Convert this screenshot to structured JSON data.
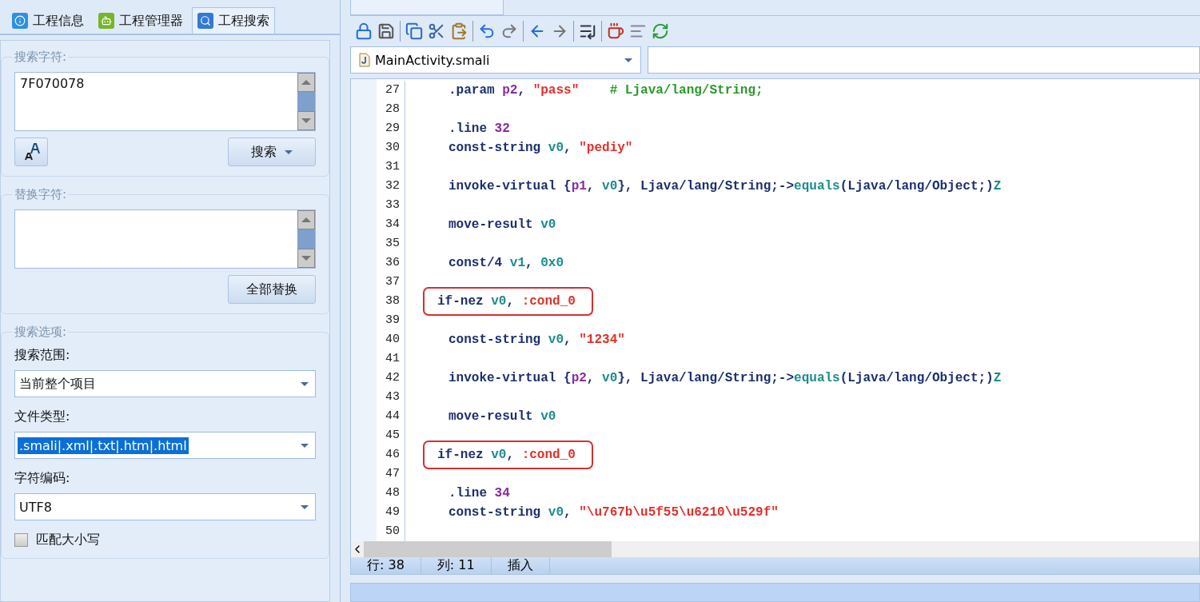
{
  "tabs": [
    {
      "label": "工程信息",
      "selected": false
    },
    {
      "label": "工程管理器",
      "selected": false
    },
    {
      "label": "工程搜索",
      "selected": true
    }
  ],
  "search_group": {
    "title": "搜索字符:",
    "value": "7F070078",
    "button": "搜索"
  },
  "replace_group": {
    "title": "替换字符:",
    "button": "全部替换"
  },
  "options_group": {
    "title": "搜索选项:",
    "fields": [
      {
        "label": "搜索范围:",
        "value": "当前整个项目",
        "highlighted": false
      },
      {
        "label": "文件类型:",
        "value": ".smali|.xml|.txt|.htm|.html",
        "highlighted": true
      },
      {
        "label": "字符编码:",
        "value": "UTF8",
        "highlighted": false
      }
    ],
    "checkbox": {
      "label": "匹配大小写",
      "checked": false
    }
  },
  "editor": {
    "file": "MainActivity.smali",
    "lines": [
      {
        "num": "27",
        "boxed": false,
        "tokens": [
          {
            "text": ".param ",
            "kind": "kw"
          },
          {
            "text": "p2",
            "kind": "num"
          },
          {
            "text": ", ",
            "kind": "plain"
          },
          {
            "text": "\"pass\"",
            "kind": "str"
          },
          {
            "text": "    # Ljava/lang/String;",
            "kind": "cmt"
          }
        ]
      },
      {
        "num": "28"
      },
      {
        "num": "29",
        "boxed": false,
        "tokens": [
          {
            "text": ".line ",
            "kind": "kw"
          },
          {
            "text": "32",
            "kind": "num"
          }
        ]
      },
      {
        "num": "30",
        "boxed": false,
        "tokens": [
          {
            "text": "const-string ",
            "kind": "kw"
          },
          {
            "text": "v0",
            "kind": "reg"
          },
          {
            "text": ", ",
            "kind": "plain"
          },
          {
            "text": "\"pediy\"",
            "kind": "str"
          }
        ]
      },
      {
        "num": "31"
      },
      {
        "num": "32",
        "boxed": false,
        "tokens": [
          {
            "text": "invoke-virtual {",
            "kind": "kw"
          },
          {
            "text": "p1",
            "kind": "num"
          },
          {
            "text": ", ",
            "kind": "plain"
          },
          {
            "text": "v0",
            "kind": "reg"
          },
          {
            "text": "}, Ljava/lang/String;->",
            "kind": "plain"
          },
          {
            "text": "equals",
            "kind": "reg"
          },
          {
            "text": "(Ljava/lang/Object;)",
            "kind": "plain"
          },
          {
            "text": "Z",
            "kind": "reg"
          }
        ]
      },
      {
        "num": "33"
      },
      {
        "num": "34",
        "boxed": false,
        "tokens": [
          {
            "text": "move-result ",
            "kind": "kw"
          },
          {
            "text": "v0",
            "kind": "reg"
          }
        ]
      },
      {
        "num": "35"
      },
      {
        "num": "36",
        "boxed": false,
        "tokens": [
          {
            "text": "const/4 ",
            "kind": "kw"
          },
          {
            "text": "v1",
            "kind": "reg"
          },
          {
            "text": ", ",
            "kind": "plain"
          },
          {
            "text": "0x0",
            "kind": "reg"
          }
        ]
      },
      {
        "num": "37"
      },
      {
        "num": "38",
        "boxed": true,
        "tokens": [
          {
            "text": "if-nez ",
            "kind": "kw"
          },
          {
            "text": "v0",
            "kind": "reg"
          },
          {
            "text": ", ",
            "kind": "plain"
          },
          {
            "text": ":cond_0",
            "kind": "str"
          }
        ]
      },
      {
        "num": "39"
      },
      {
        "num": "40",
        "boxed": false,
        "tokens": [
          {
            "text": "const-string ",
            "kind": "kw"
          },
          {
            "text": "v0",
            "kind": "reg"
          },
          {
            "text": ", ",
            "kind": "plain"
          },
          {
            "text": "\"1234\"",
            "kind": "str"
          }
        ]
      },
      {
        "num": "41"
      },
      {
        "num": "42",
        "boxed": false,
        "tokens": [
          {
            "text": "invoke-virtual {",
            "kind": "kw"
          },
          {
            "text": "p2",
            "kind": "num"
          },
          {
            "text": ", ",
            "kind": "plain"
          },
          {
            "text": "v0",
            "kind": "reg"
          },
          {
            "text": "}, Ljava/lang/String;->",
            "kind": "plain"
          },
          {
            "text": "equals",
            "kind": "reg"
          },
          {
            "text": "(Ljava/lang/Object;)",
            "kind": "plain"
          },
          {
            "text": "Z",
            "kind": "reg"
          }
        ]
      },
      {
        "num": "43"
      },
      {
        "num": "44",
        "boxed": false,
        "tokens": [
          {
            "text": "move-result ",
            "kind": "kw"
          },
          {
            "text": "v0",
            "kind": "reg"
          }
        ]
      },
      {
        "num": "45"
      },
      {
        "num": "46",
        "boxed": true,
        "tokens": [
          {
            "text": "if-nez ",
            "kind": "kw"
          },
          {
            "text": "v0",
            "kind": "reg"
          },
          {
            "text": ", ",
            "kind": "plain"
          },
          {
            "text": ":cond_0",
            "kind": "str"
          }
        ]
      },
      {
        "num": "47"
      },
      {
        "num": "48",
        "boxed": false,
        "tokens": [
          {
            "text": ".line ",
            "kind": "kw"
          },
          {
            "text": "34",
            "kind": "num"
          }
        ]
      },
      {
        "num": "49",
        "boxed": false,
        "tokens": [
          {
            "text": "const-string ",
            "kind": "kw"
          },
          {
            "text": "v0",
            "kind": "reg"
          },
          {
            "text": ", ",
            "kind": "plain"
          },
          {
            "text": "\"\\u767b\\u5f55\\u6210\\u529f\"",
            "kind": "str"
          }
        ]
      },
      {
        "num": "50"
      }
    ]
  },
  "status_bar": [
    "行: 38",
    "列: 11",
    "插入"
  ]
}
